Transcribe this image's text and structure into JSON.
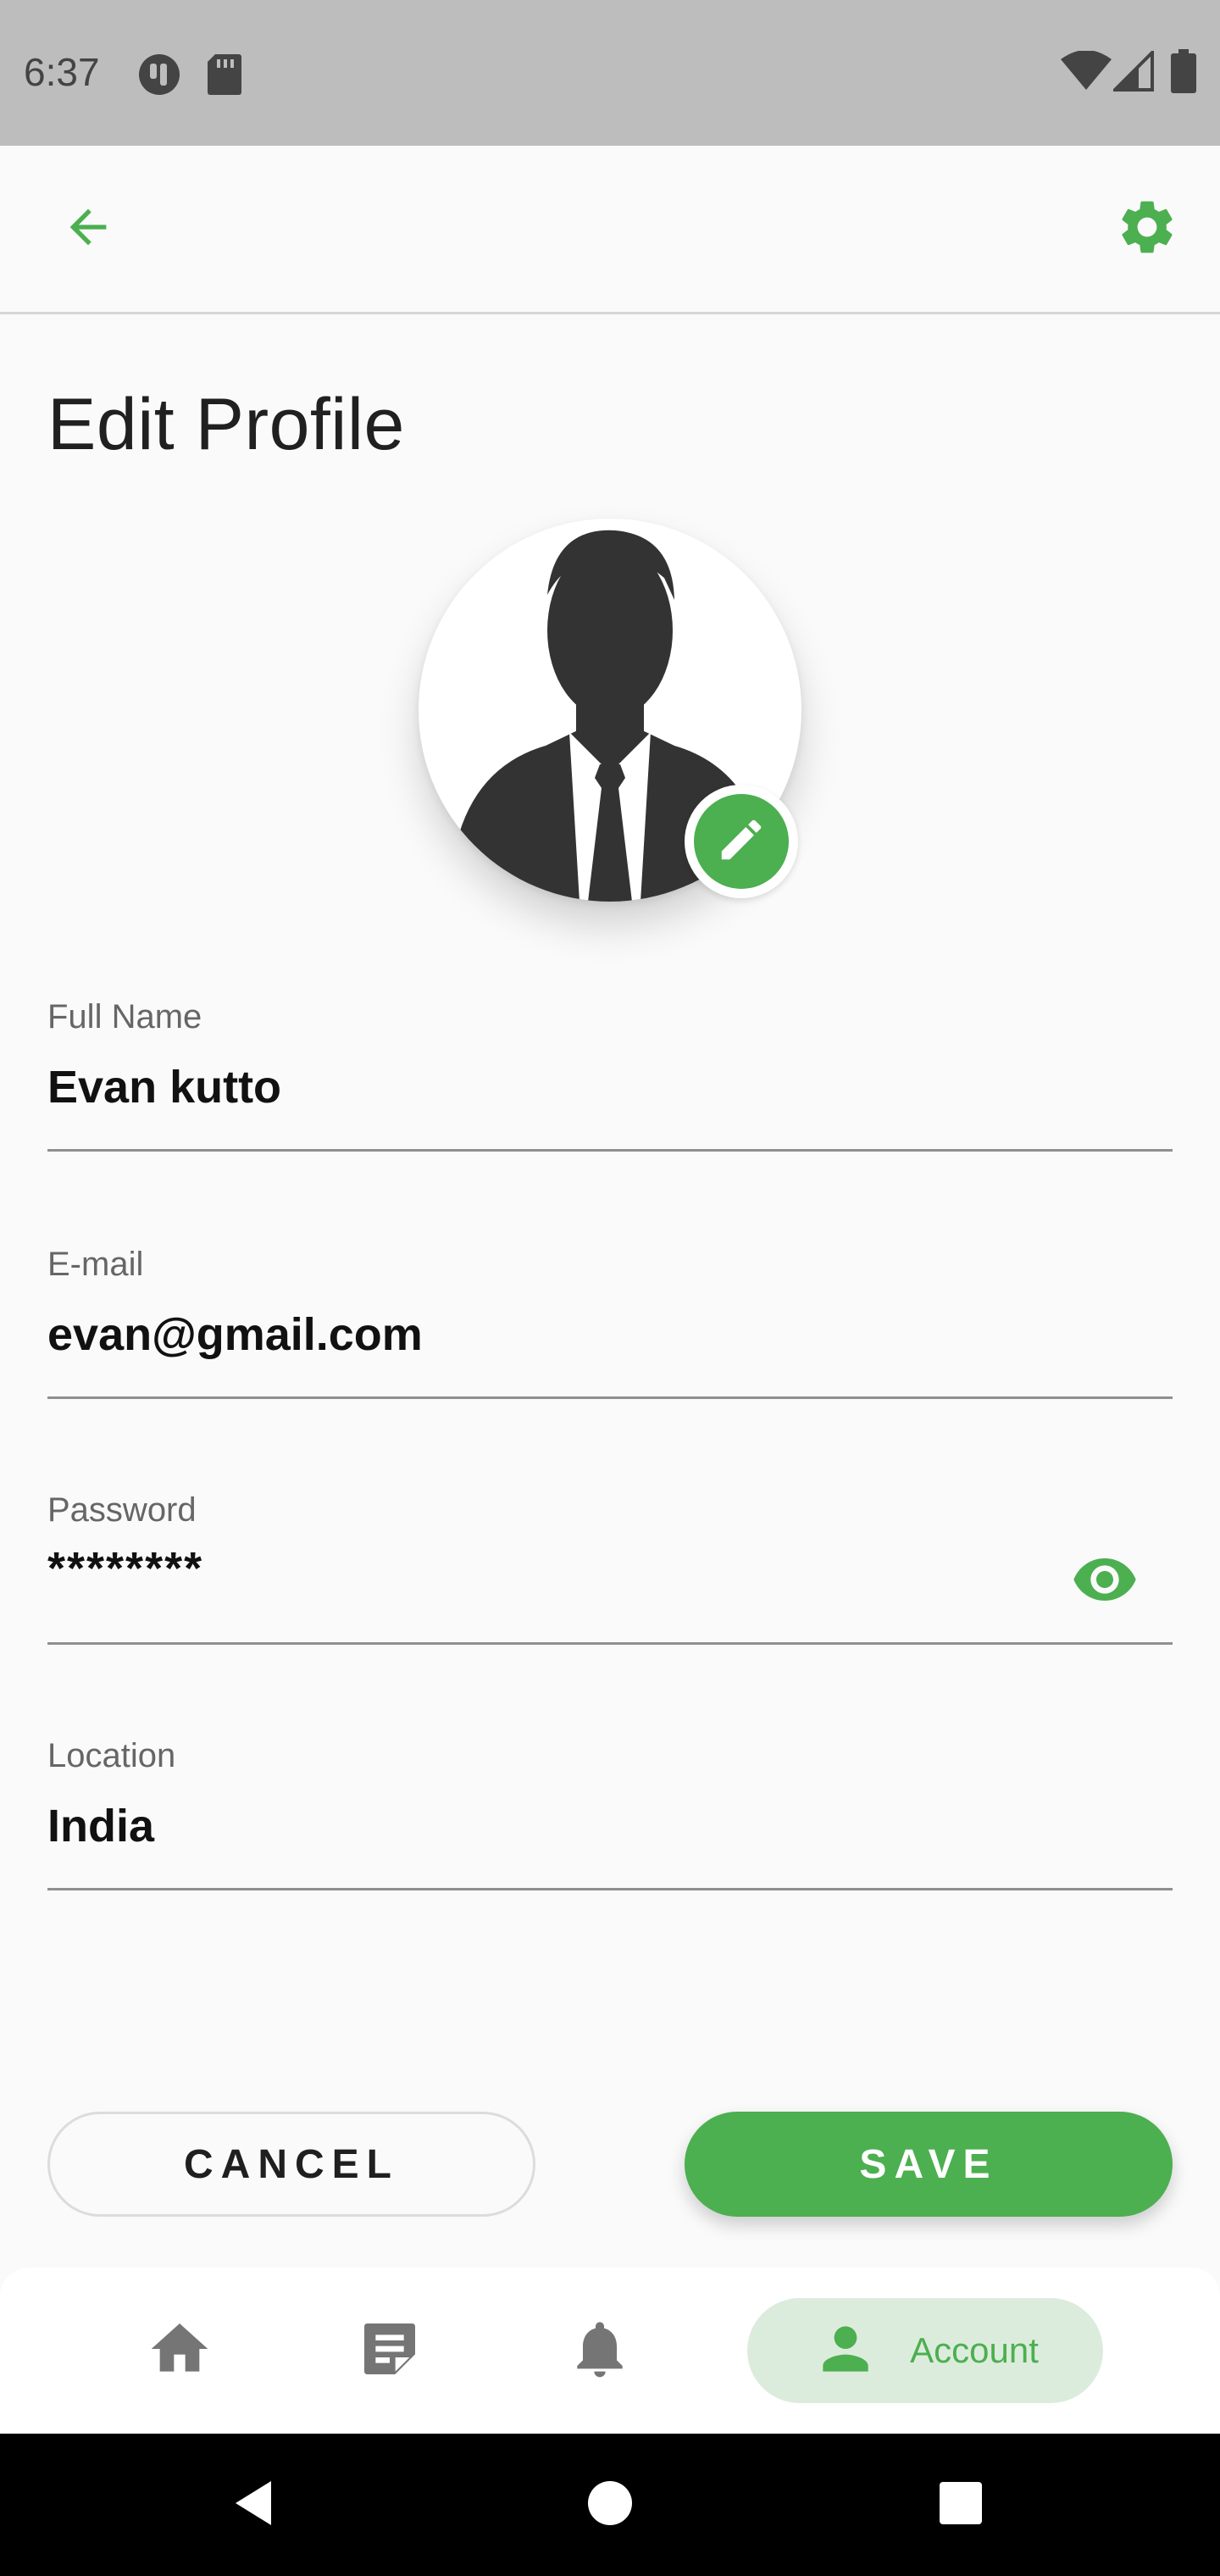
{
  "status_bar": {
    "time": "6:37",
    "left_icons": [
      "app-notification-icon",
      "sd-card-icon"
    ],
    "right_icons": [
      "wifi-icon",
      "cell-signal-icon",
      "battery-icon"
    ]
  },
  "app_bar": {
    "back_icon": "arrow-back-icon",
    "settings_icon": "gear-icon",
    "accent": "#4caf50"
  },
  "page": {
    "title": "Edit Profile"
  },
  "avatar": {
    "image": "business-person-silhouette",
    "edit_icon": "pencil-icon"
  },
  "form": {
    "full_name": {
      "label": "Full Name",
      "value": "Evan kutto"
    },
    "email": {
      "label": "E-mail",
      "value": "evan@gmail.com"
    },
    "password": {
      "label": "Password",
      "value": "********",
      "toggle_icon": "eye-icon"
    },
    "location": {
      "label": "Location",
      "value": "India"
    }
  },
  "actions": {
    "cancel_label": "CANCEL",
    "save_label": "SAVE"
  },
  "bottom_nav": {
    "items": [
      {
        "icon": "home-icon"
      },
      {
        "icon": "notes-icon"
      },
      {
        "icon": "bell-icon"
      },
      {
        "icon": "person-icon",
        "label": "Account",
        "active": true
      }
    ]
  },
  "system_nav": {
    "icons": [
      "back-triangle-icon",
      "home-circle-icon",
      "recents-square-icon"
    ]
  }
}
